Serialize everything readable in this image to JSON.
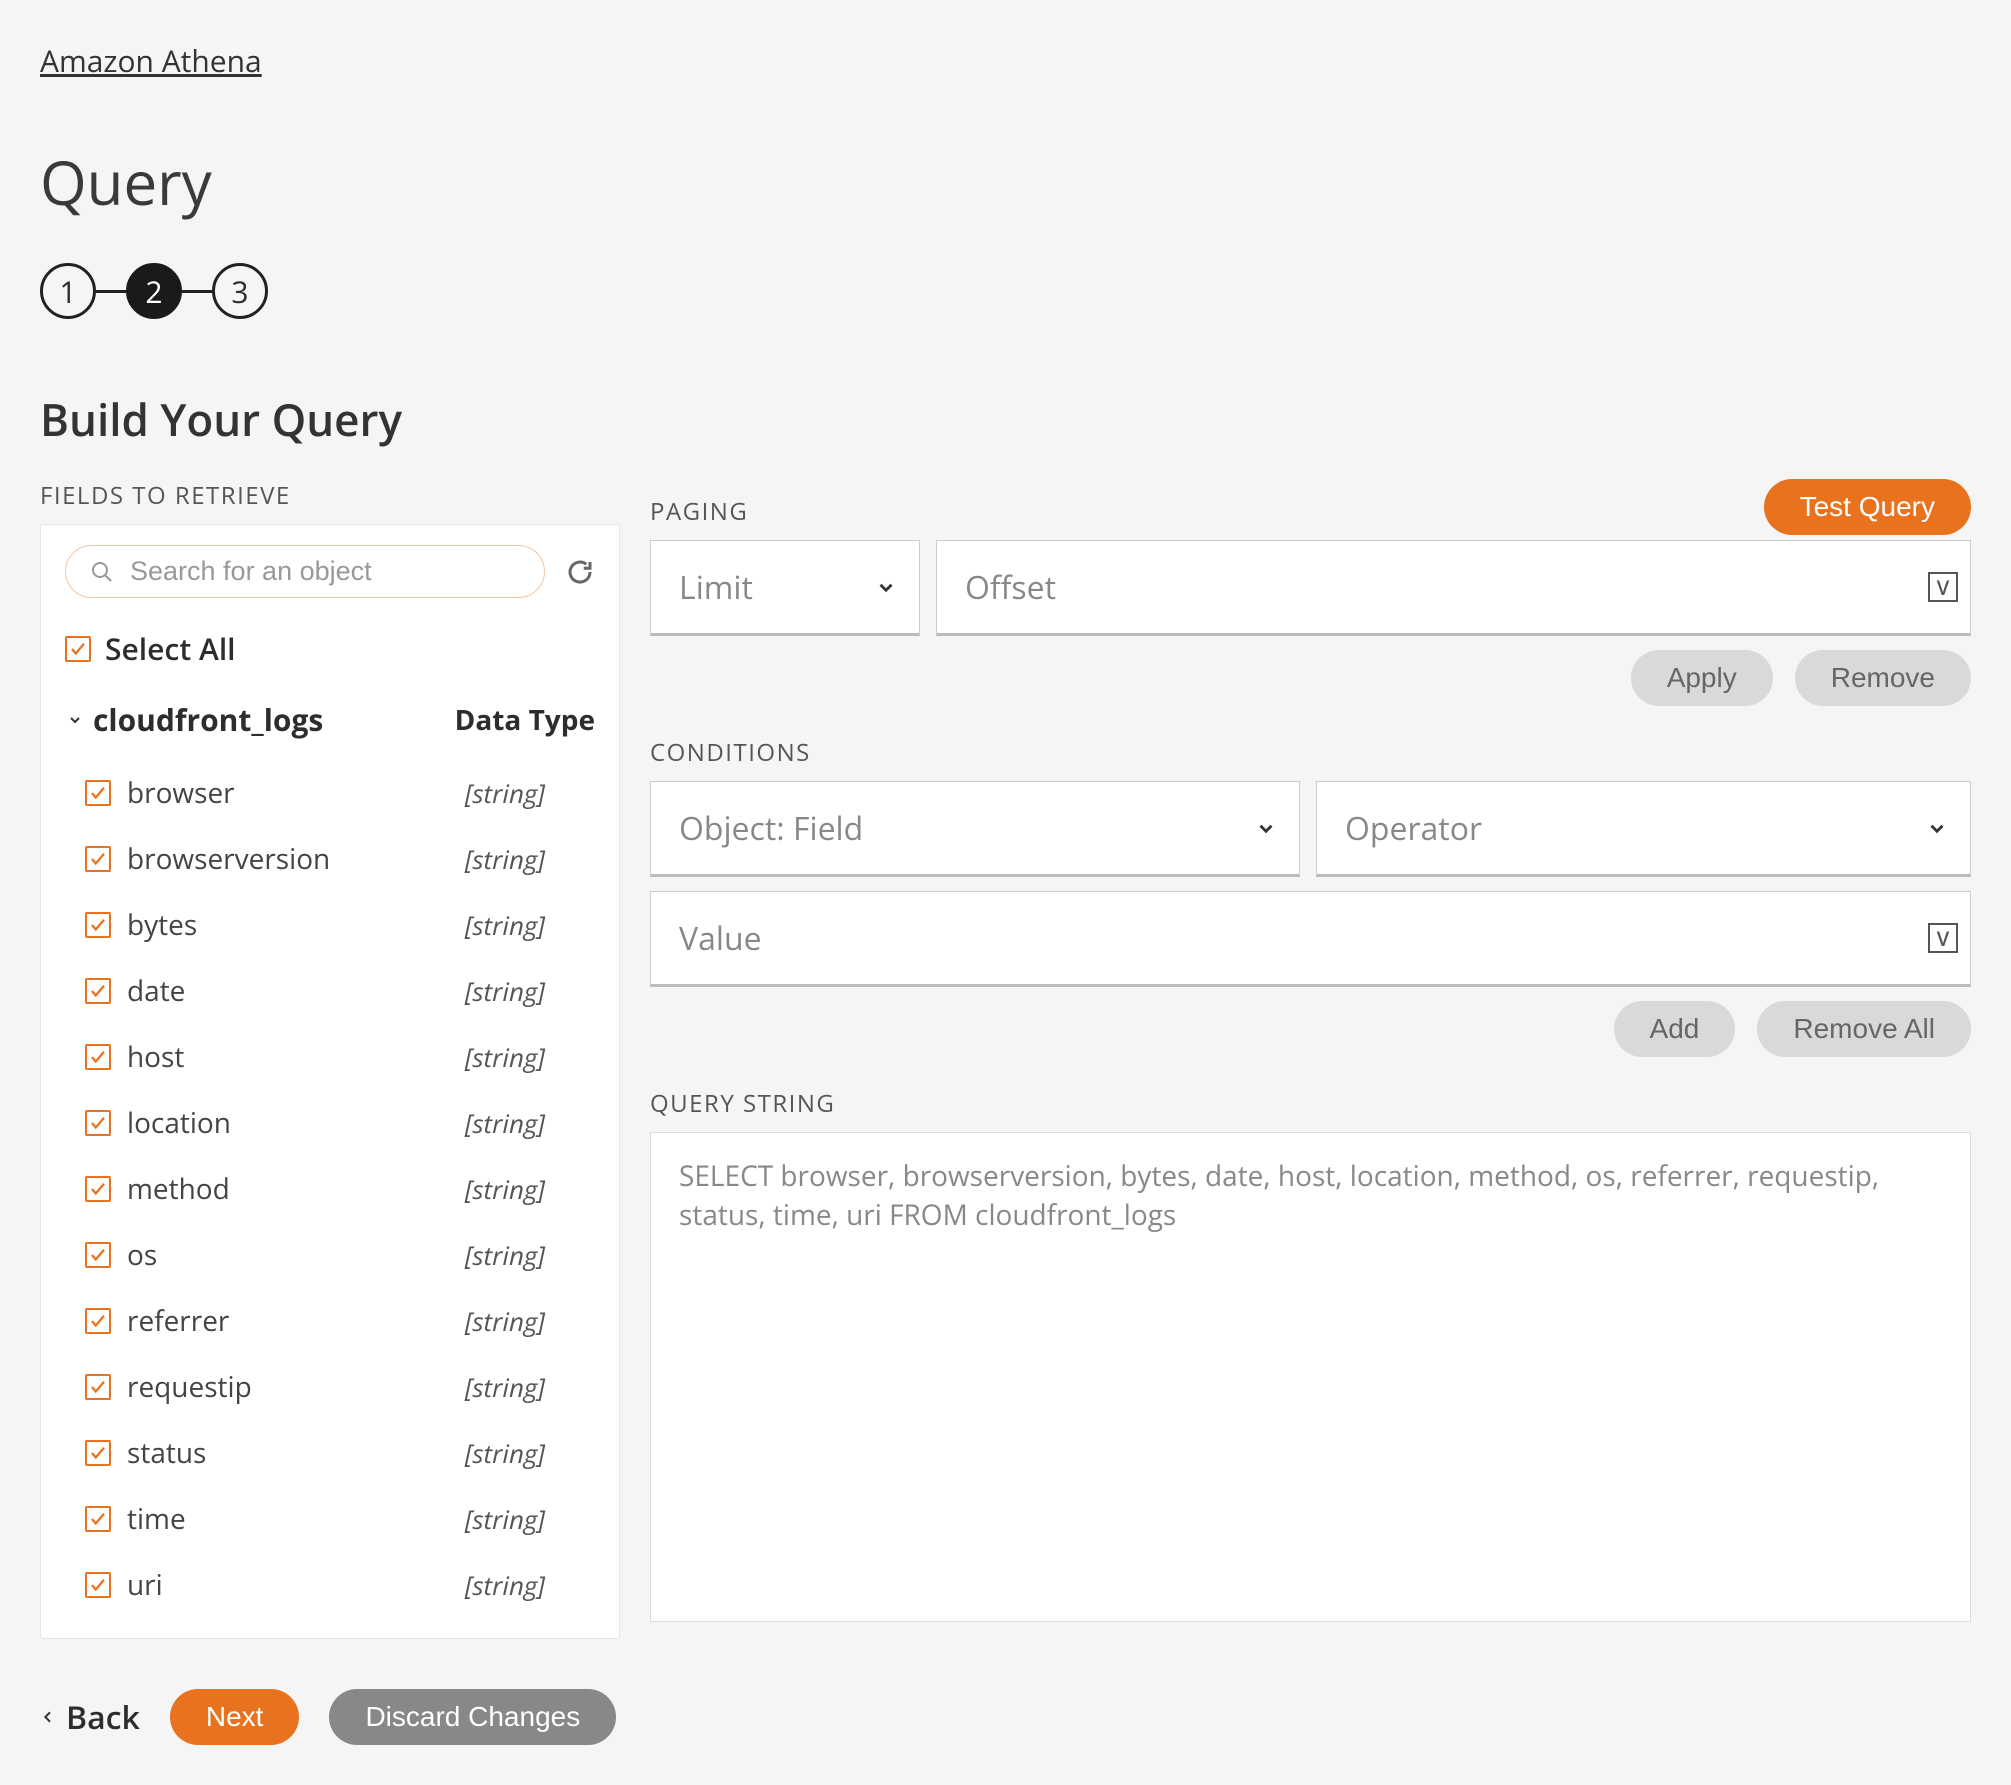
{
  "breadcrumb": "Amazon Athena",
  "title": "Query",
  "stepper": {
    "steps": [
      "1",
      "2",
      "3"
    ],
    "active": 1
  },
  "section_title": "Build Your Query",
  "fields_panel": {
    "label": "FIELDS TO RETRIEVE",
    "search_placeholder": "Search for an object",
    "select_all": "Select All",
    "table": "cloudfront_logs",
    "data_type_header": "Data Type",
    "fields": [
      {
        "name": "browser",
        "type": "[string]"
      },
      {
        "name": "browserversion",
        "type": "[string]"
      },
      {
        "name": "bytes",
        "type": "[string]"
      },
      {
        "name": "date",
        "type": "[string]"
      },
      {
        "name": "host",
        "type": "[string]"
      },
      {
        "name": "location",
        "type": "[string]"
      },
      {
        "name": "method",
        "type": "[string]"
      },
      {
        "name": "os",
        "type": "[string]"
      },
      {
        "name": "referrer",
        "type": "[string]"
      },
      {
        "name": "requestip",
        "type": "[string]"
      },
      {
        "name": "status",
        "type": "[string]"
      },
      {
        "name": "time",
        "type": "[string]"
      },
      {
        "name": "uri",
        "type": "[string]"
      }
    ]
  },
  "right": {
    "test_query": "Test Query",
    "paging_label": "PAGING",
    "limit_placeholder": "Limit",
    "offset_placeholder": "Offset",
    "apply": "Apply",
    "remove": "Remove",
    "conditions_label": "CONDITIONS",
    "object_field_placeholder": "Object: Field",
    "operator_placeholder": "Operator",
    "value_placeholder": "Value",
    "add": "Add",
    "remove_all": "Remove All",
    "query_string_label": "QUERY STRING",
    "query_string": "SELECT browser, browserversion, bytes, date, host, location, method, os, referrer, requestip, status, time, uri FROM cloudfront_logs",
    "v_token": "V"
  },
  "footer": {
    "back": "Back",
    "next": "Next",
    "discard": "Discard Changes"
  }
}
